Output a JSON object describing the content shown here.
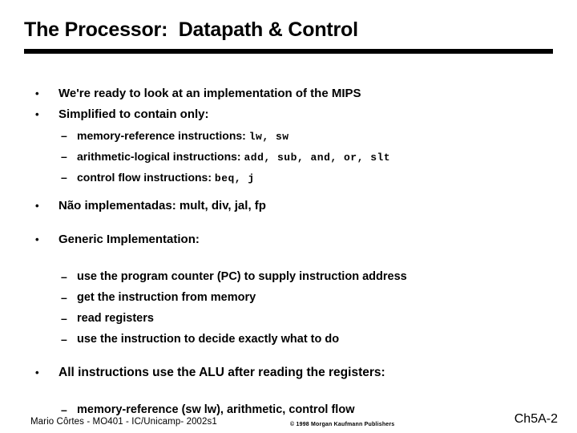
{
  "slide": {
    "title": "The Processor:  Datapath & Control",
    "background_color": "#ffffff",
    "text_color": "#000000",
    "rule_color": "#000000"
  },
  "bullets": {
    "b1": {
      "marker": "•",
      "text": "We're ready to look at an implementation of the MIPS"
    },
    "b2": {
      "marker": "•",
      "text": "Simplified to contain only:"
    },
    "b2s1": {
      "marker": "–",
      "text": "memory-reference instructions: ",
      "mono": "lw, sw"
    },
    "b2s2": {
      "marker": "–",
      "text": "arithmetic-logical instructions: ",
      "mono": "add, sub, and, or, slt"
    },
    "b2s3": {
      "marker": "–",
      "text": "control flow instructions: ",
      "mono": "beq, j"
    },
    "b3": {
      "marker": "•",
      "text": "Não implementadas: mult, div, jal, fp"
    },
    "b4": {
      "marker": "•",
      "text": "Generic Implementation:"
    },
    "b4s1": {
      "marker": "–",
      "text": "use the program counter (PC) to supply instruction address"
    },
    "b4s2": {
      "marker": "–",
      "text": "get the instruction from memory"
    },
    "b4s3": {
      "marker": "–",
      "text": "read registers"
    },
    "b4s4": {
      "marker": "–",
      "text": "use the instruction to decide exactly what to do"
    },
    "b5": {
      "marker": "•",
      "text": "All instructions use the ALU after reading the registers:"
    },
    "b5s1": {
      "marker": "–",
      "text": "memory-reference (sw lw), arithmetic, control flow"
    }
  },
  "footer": {
    "left": "Mario Côrtes - MO401 - IC/Unicamp- 2002s1",
    "center": "© 1998 Morgan Kaufmann Publishers",
    "right": "Ch5A-2"
  }
}
